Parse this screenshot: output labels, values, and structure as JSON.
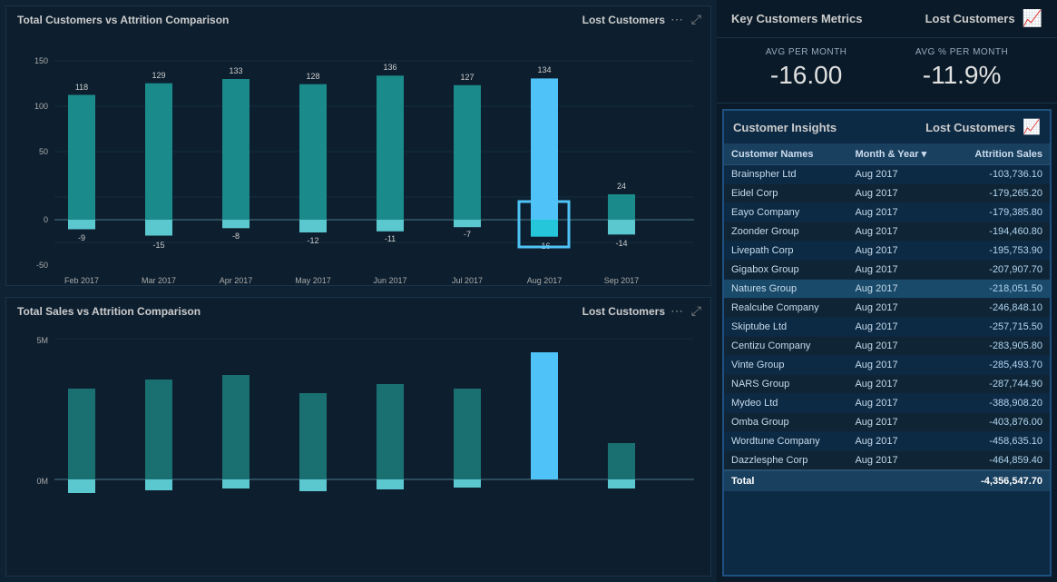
{
  "leftTop": {
    "title": "Total Customers vs Attrition Comparison",
    "badge": "Lost Customers",
    "chart": {
      "months": [
        "Feb 2017",
        "Mar 2017",
        "Apr 2017",
        "May 2017",
        "Jun 2017",
        "Jul 2017",
        "Aug 2017",
        "Sep 2017"
      ],
      "posValues": [
        118,
        129,
        133,
        128,
        136,
        127,
        134,
        24
      ],
      "negValues": [
        -9,
        -15,
        -8,
        -12,
        -11,
        -7,
        -16,
        -14
      ],
      "yMax": 150,
      "yMin": -50
    }
  },
  "leftBottom": {
    "title": "Total Sales vs Attrition Comparison",
    "badge": "Lost Customers"
  },
  "rightMetrics": {
    "headerTitle": "Key Customers Metrics",
    "headerLost": "Lost Customers",
    "avgPerMonth": {
      "label": "AVG PER MONTH",
      "value": "-16.00"
    },
    "avgPctPerMonth": {
      "label": "AVG % PER MONTH",
      "value": "-11.9%"
    }
  },
  "insights": {
    "title": "Customer Insights",
    "lostLabel": "Lost Customers",
    "columns": [
      "Customer Names",
      "Month & Year",
      "Attrition Sales"
    ],
    "rows": [
      {
        "name": "Brainspher Ltd",
        "month": "Aug 2017",
        "sales": "-103,736.10"
      },
      {
        "name": "Eidel Corp",
        "month": "Aug 2017",
        "sales": "-179,265.20"
      },
      {
        "name": "Eayo Company",
        "month": "Aug 2017",
        "sales": "-179,385.80"
      },
      {
        "name": "Zoonder Group",
        "month": "Aug 2017",
        "sales": "-194,460.80"
      },
      {
        "name": "Livepath Corp",
        "month": "Aug 2017",
        "sales": "-195,753.90"
      },
      {
        "name": "Gigabox Group",
        "month": "Aug 2017",
        "sales": "-207,907.70"
      },
      {
        "name": "Natures Group",
        "month": "Aug 2017",
        "sales": "-218,051.50"
      },
      {
        "name": "Realcube Company",
        "month": "Aug 2017",
        "sales": "-246,848.10"
      },
      {
        "name": "Skiptube Ltd",
        "month": "Aug 2017",
        "sales": "-257,715.50"
      },
      {
        "name": "Centizu Company",
        "month": "Aug 2017",
        "sales": "-283,905.80"
      },
      {
        "name": "Vinte Group",
        "month": "Aug 2017",
        "sales": "-285,493.70"
      },
      {
        "name": "NARS Group",
        "month": "Aug 2017",
        "sales": "-287,744.90"
      },
      {
        "name": "Mydeo Ltd",
        "month": "Aug 2017",
        "sales": "-388,908.20"
      },
      {
        "name": "Omba Group",
        "month": "Aug 2017",
        "sales": "-403,876.00"
      },
      {
        "name": "Wordtune Company",
        "month": "Aug 2017",
        "sales": "-458,635.10"
      },
      {
        "name": "Dazzlesphe Corp",
        "month": "Aug 2017",
        "sales": "-464,859.40"
      }
    ],
    "total": {
      "label": "Total",
      "value": "-4,356,547.70"
    }
  }
}
